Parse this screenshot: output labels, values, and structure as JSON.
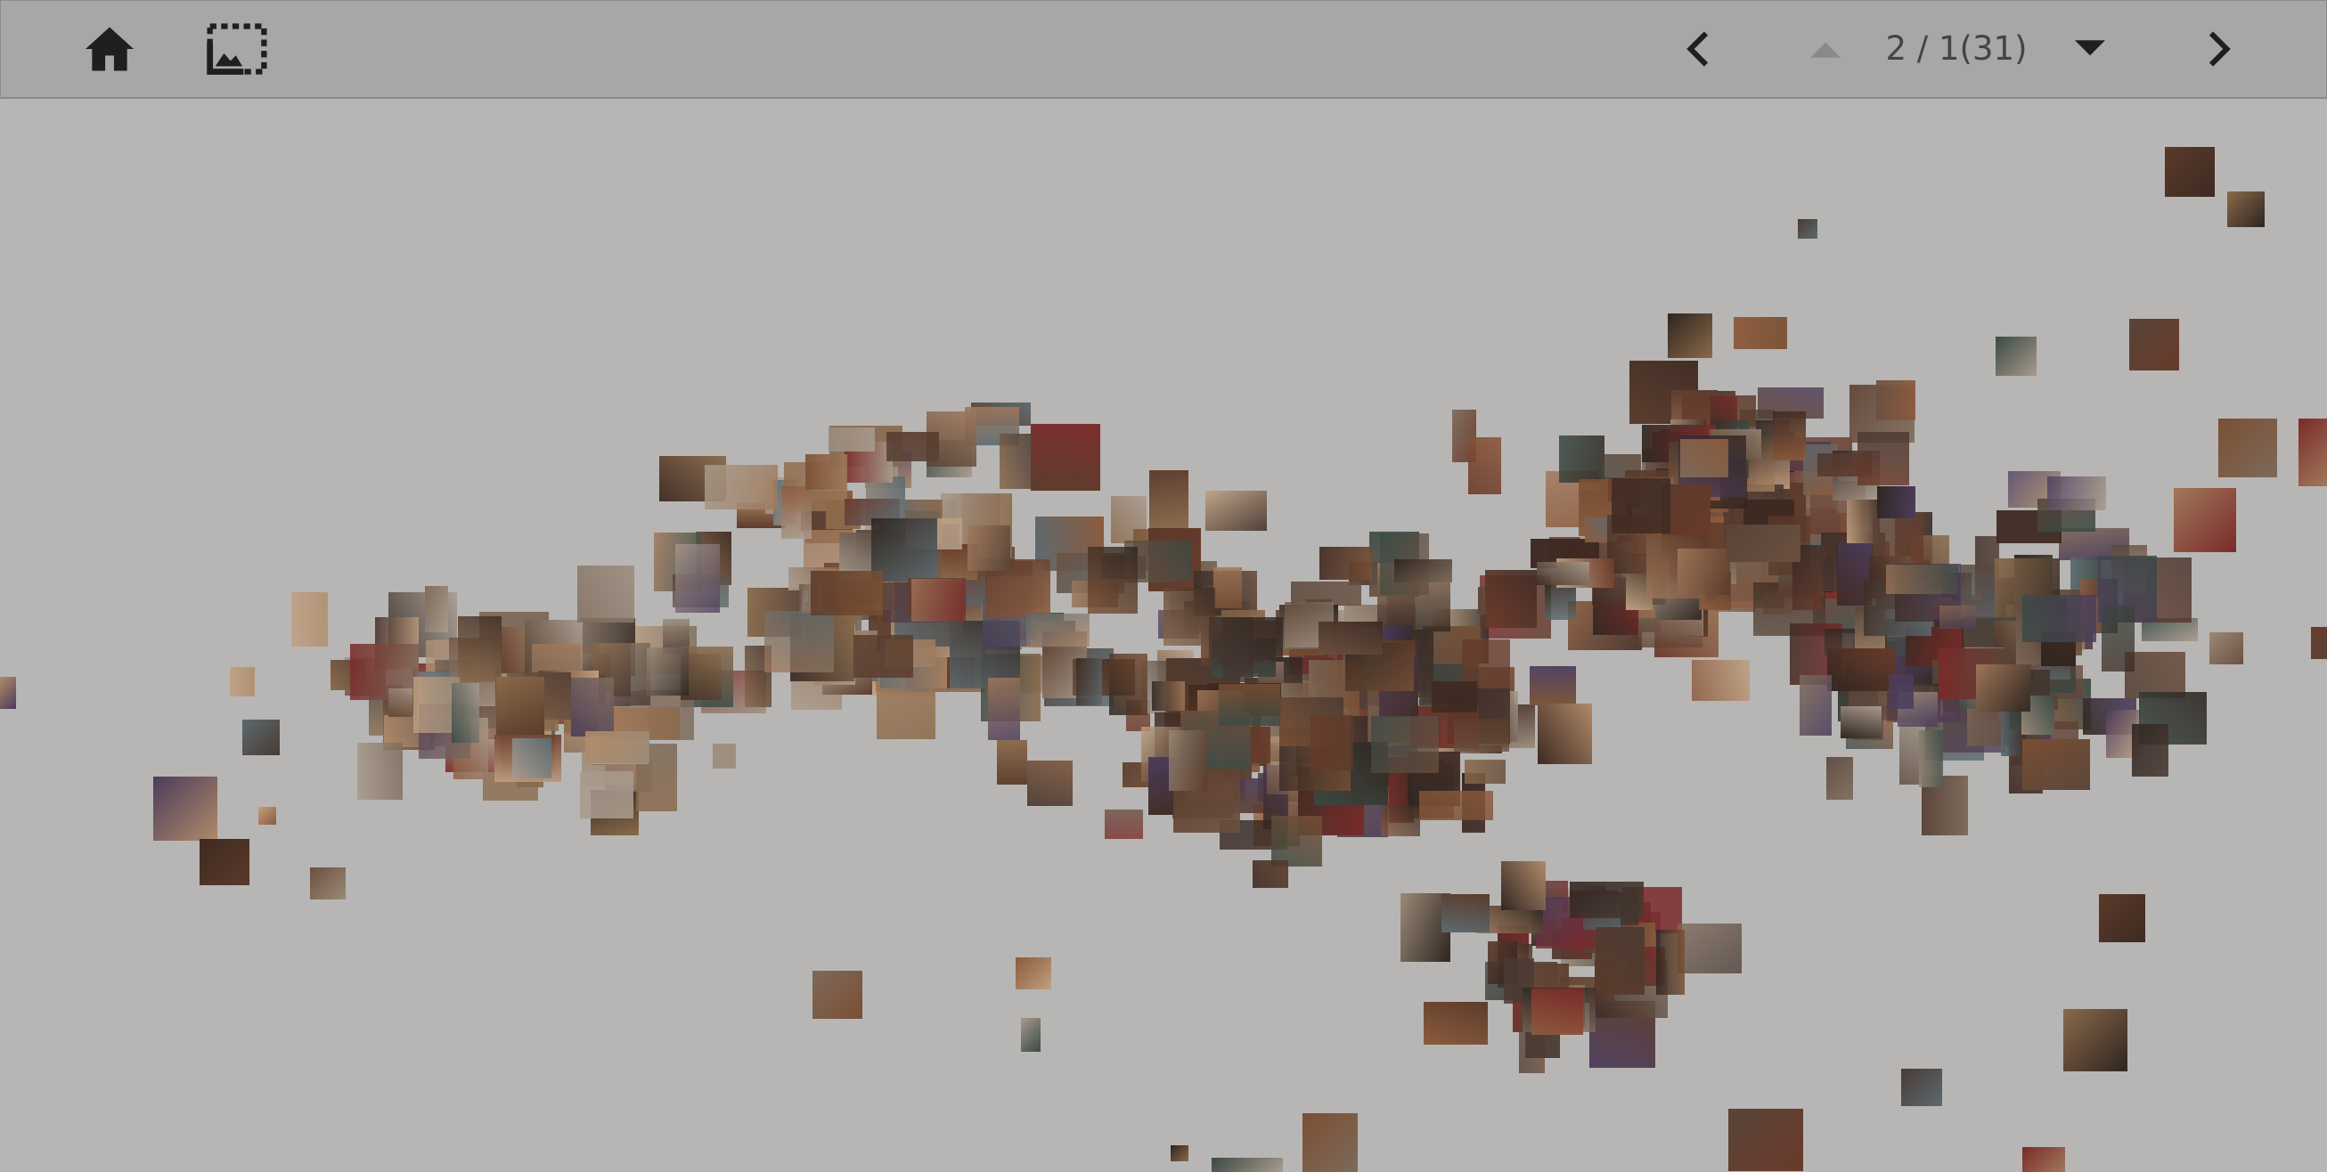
{
  "toolbar": {
    "home_icon": "home-icon",
    "selection_icon": "image-selection-icon",
    "prev_icon": "chevron-left-icon",
    "up_icon": "caret-up-icon",
    "down_icon": "caret-down-icon",
    "next_icon": "chevron-right-icon",
    "page_indicator": "2 / 1(31)"
  },
  "colors": {
    "background": "#b7b6b4",
    "toolbar": "#a8a7a5",
    "icon_dark": "#1f1f1f",
    "icon_disabled": "#8a8988"
  },
  "canvas": {
    "description_type": "image-cluster-scatter",
    "palette": [
      "#5a3a2a",
      "#7a4f33",
      "#3e2a22",
      "#8a6a4a",
      "#a0785a",
      "#6b5040",
      "#4a3a33",
      "#9a8a78",
      "#c0a080",
      "#2f2520",
      "#6a3a2a",
      "#7d6a5a",
      "#584438",
      "#b08a68",
      "#8c5a3c",
      "#3a4a44",
      "#5c6a70",
      "#a89a8c",
      "#7a2a2a",
      "#4c3c5c"
    ]
  }
}
